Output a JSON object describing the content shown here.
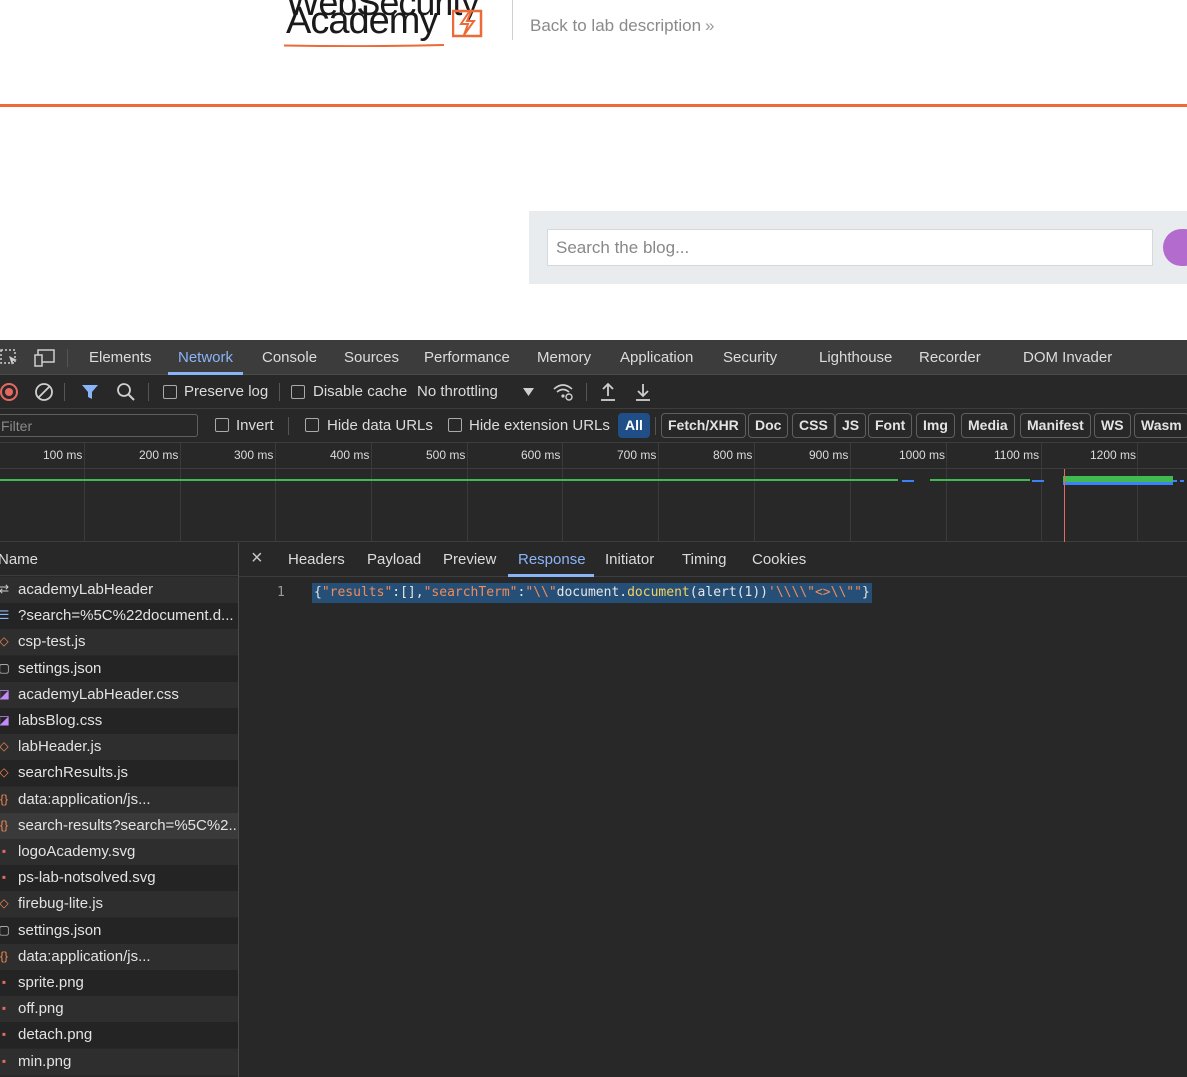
{
  "site": {
    "logo_line1": "WebSecurity",
    "logo_line2": "Academy",
    "back_link": "Back to lab description",
    "back_chevron": "»",
    "search_placeholder": "Search the blog...",
    "colors": {
      "accent_orange": "#ec6a37",
      "search_button": "#b36ccd",
      "search_panel": "#e8ecee"
    }
  },
  "devtools": {
    "tabs": [
      "Elements",
      "Network",
      "Console",
      "Sources",
      "Performance",
      "Memory",
      "Application",
      "Security",
      "Lighthouse",
      "Recorder",
      "DOM Invader"
    ],
    "active_tab": "Network",
    "toolbar": {
      "preserve_log": "Preserve log",
      "disable_cache": "Disable cache",
      "throttling": "No throttling"
    },
    "filter": {
      "placeholder": "Filter",
      "invert": "Invert",
      "hide_data_urls": "Hide data URLs",
      "hide_extension_urls": "Hide extension URLs",
      "type_pills": [
        "All",
        "Fetch/XHR",
        "Doc",
        "CSS",
        "JS",
        "Font",
        "Img",
        "Media",
        "Manifest",
        "WS",
        "Wasm"
      ],
      "active_pill": "All"
    },
    "timeline": {
      "labels": [
        "100 ms",
        "200 ms",
        "300 ms",
        "400 ms",
        "500 ms",
        "600 ms",
        "700 ms",
        "800 ms",
        "900 ms",
        "1000 ms",
        "1100 ms",
        "1200 ms"
      ]
    },
    "request_list": {
      "header": "Name",
      "items": [
        {
          "name": "academyLabHeader",
          "icon": "websocket-icon"
        },
        {
          "name": "?search=%5C%22document.d...",
          "icon": "document-icon"
        },
        {
          "name": "csp-test.js",
          "icon": "script-icon"
        },
        {
          "name": "settings.json",
          "icon": "file-icon"
        },
        {
          "name": "academyLabHeader.css",
          "icon": "stylesheet-icon"
        },
        {
          "name": "labsBlog.css",
          "icon": "stylesheet-icon"
        },
        {
          "name": "labHeader.js",
          "icon": "script-icon"
        },
        {
          "name": "searchResults.js",
          "icon": "script-icon"
        },
        {
          "name": "data:application/js...",
          "icon": "json-icon"
        },
        {
          "name": "search-results?search=%5C%2...",
          "icon": "json-icon"
        },
        {
          "name": "logoAcademy.svg",
          "icon": "image-icon"
        },
        {
          "name": "ps-lab-notsolved.svg",
          "icon": "image-icon"
        },
        {
          "name": "firebug-lite.js",
          "icon": "script-icon"
        },
        {
          "name": "settings.json",
          "icon": "file-icon"
        },
        {
          "name": "data:application/js...",
          "icon": "json-icon"
        },
        {
          "name": "sprite.png",
          "icon": "image-icon"
        },
        {
          "name": "off.png",
          "icon": "image-icon"
        },
        {
          "name": "detach.png",
          "icon": "image-icon"
        },
        {
          "name": "min.png",
          "icon": "image-icon"
        }
      ],
      "selected_index": 9
    },
    "detail": {
      "tabs": [
        "Headers",
        "Payload",
        "Preview",
        "Response",
        "Initiator",
        "Timing",
        "Cookies"
      ],
      "active_tab": "Response",
      "line_number": "1",
      "response_tokens": [
        {
          "t": "{",
          "c": "plain"
        },
        {
          "t": "\"results\"",
          "c": "key"
        },
        {
          "t": ":[],",
          "c": "plain"
        },
        {
          "t": "\"searchTerm\"",
          "c": "key"
        },
        {
          "t": ":",
          "c": "plain"
        },
        {
          "t": "\"\\\\\"",
          "c": "str"
        },
        {
          "t": "document.",
          "c": "plain"
        },
        {
          "t": "document",
          "c": "fn"
        },
        {
          "t": "(alert(1))",
          "c": "plain"
        },
        {
          "t": "'\\\\\\\\\"<>\\\\\"\"",
          "c": "str"
        },
        {
          "t": "}",
          "c": "plain"
        }
      ]
    }
  }
}
